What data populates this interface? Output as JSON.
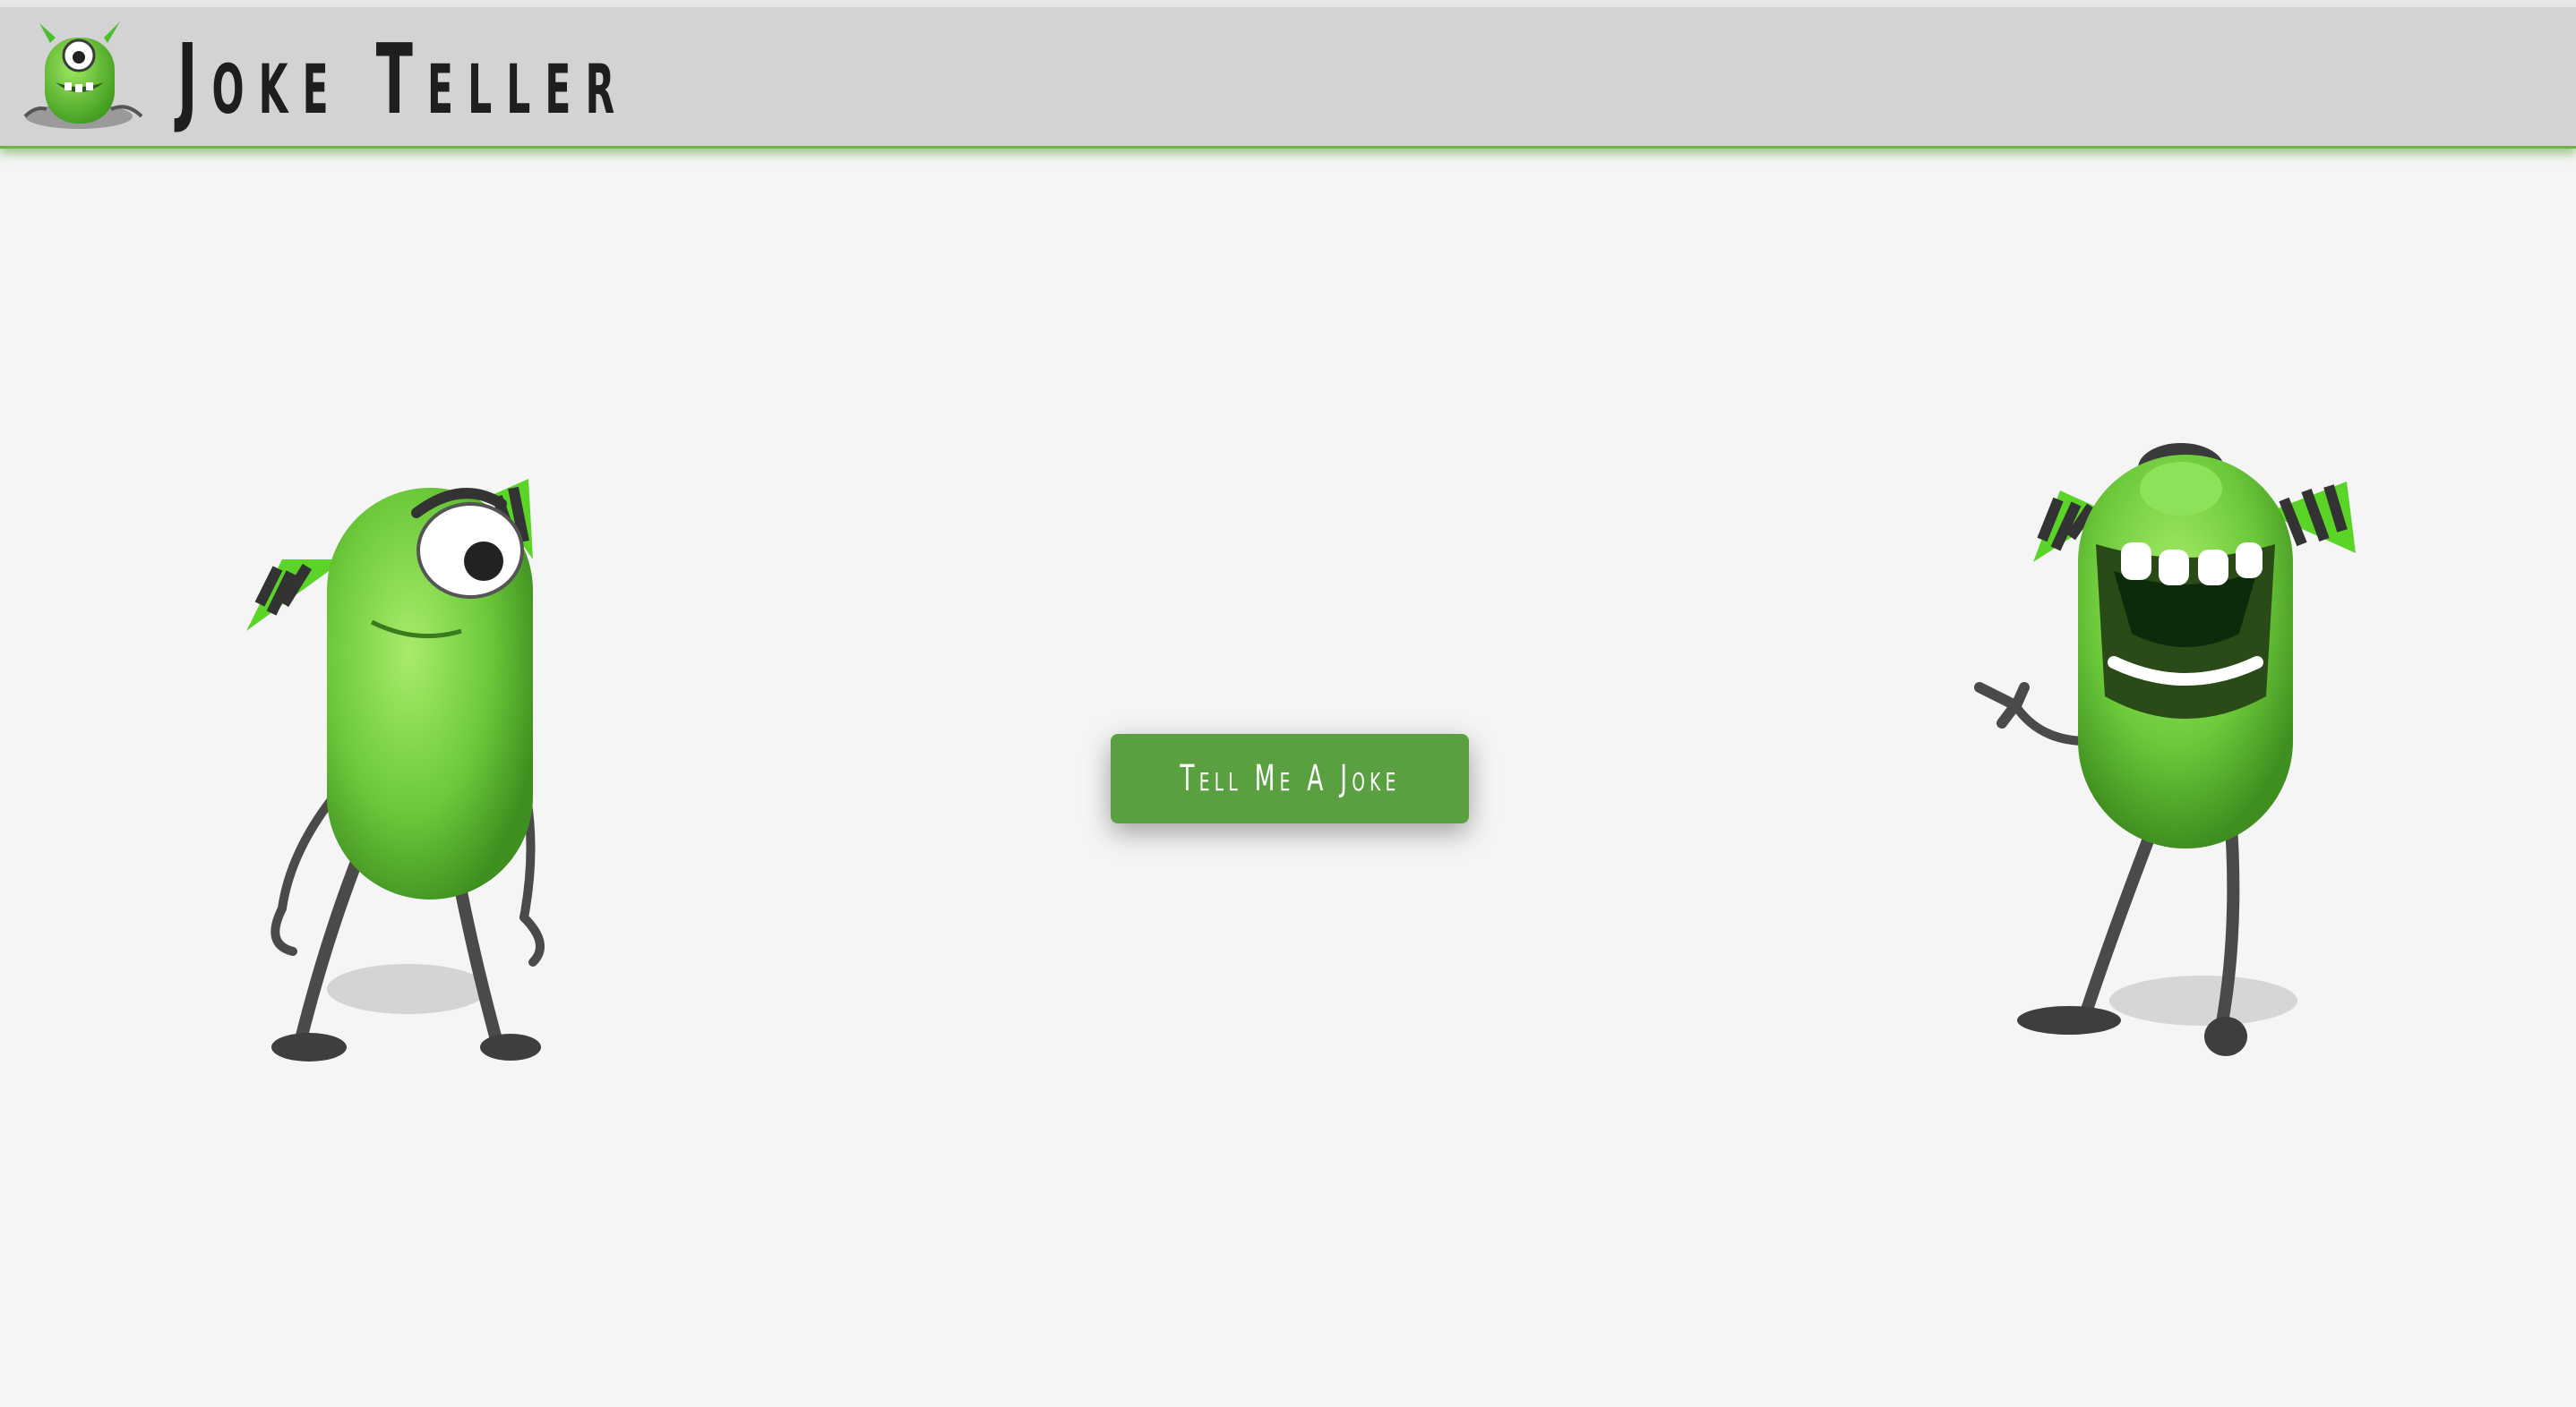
{
  "header": {
    "title": "Joke Teller",
    "logo_icon": "monster-logo-icon"
  },
  "main": {
    "button_label": "Tell Me A Joke"
  },
  "colors": {
    "accent": "#5aa041",
    "header_bg": "#d3d3d3",
    "page_bg": "#f5f5f5",
    "monster_green": "#6fcf3a",
    "horn_dark": "#333333"
  },
  "characters": [
    {
      "icon": "monster-left-icon"
    },
    {
      "icon": "monster-right-icon"
    }
  ]
}
